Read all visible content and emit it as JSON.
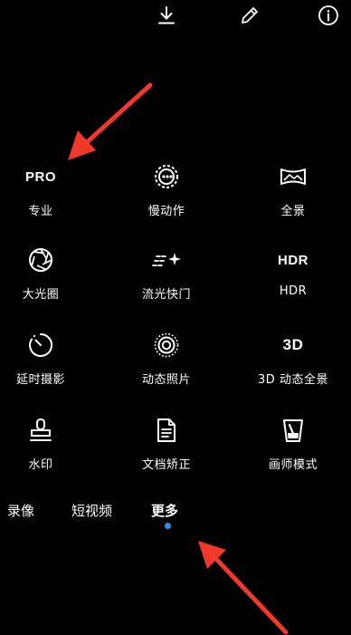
{
  "topbar": {
    "icons": [
      "download-icon",
      "edit-pencil-icon",
      "info-icon"
    ]
  },
  "modes": [
    {
      "icon_text": "PRO",
      "label": "专业"
    },
    {
      "icon": "slow-motion-icon",
      "label": "慢动作"
    },
    {
      "icon": "panorama-icon",
      "label": "全景"
    },
    {
      "icon": "aperture-icon",
      "label": "大光圈"
    },
    {
      "icon": "light-painting-icon",
      "label": "流光快门"
    },
    {
      "icon_text": "HDR",
      "label": "HDR"
    },
    {
      "icon": "timer-icon",
      "label": "延时摄影"
    },
    {
      "icon": "moving-picture-icon",
      "label": "动态照片"
    },
    {
      "icon_text": "3D",
      "label": "3D 动态全景"
    },
    {
      "icon": "watermark-stamp-icon",
      "label": "水印"
    },
    {
      "icon": "document-icon",
      "label": "文档矫正"
    },
    {
      "icon": "paint-cup-icon",
      "label": "画师模式"
    }
  ],
  "tabs": [
    {
      "label": "录像"
    },
    {
      "label": "短视频"
    },
    {
      "label": "更多",
      "active": true
    }
  ],
  "colors": {
    "background": "#000000",
    "text": "#ffffff",
    "active_dot": "#2f8ff0",
    "annotation_arrow": "#f0392b"
  }
}
